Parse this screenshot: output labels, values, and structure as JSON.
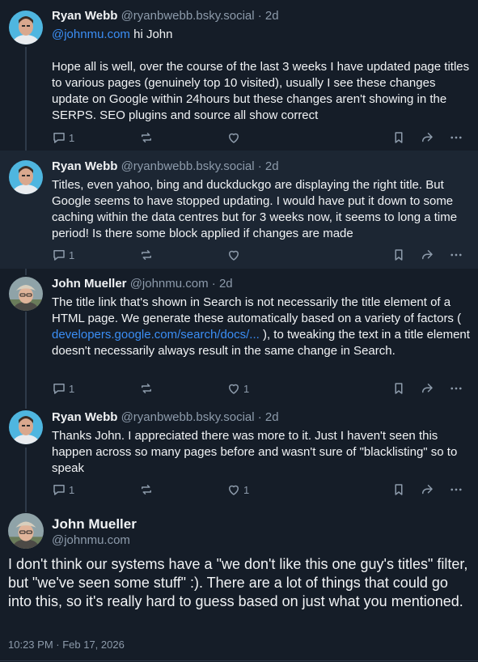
{
  "posts": [
    {
      "name": "Ryan Webb",
      "handle": "@ryanbwebb.bsky.social · 2d",
      "mention": "@johnmu.com",
      "line1_rest": " hi John",
      "para2": "Hope all is well, over the course of the last 3 weeks I have updated page titles to various pages (genuinely top 10 visited), usually I see these changes update on Google within 24hours but these changes aren't showing in the SERPS. SEO plugins and source all show correct",
      "reply_count": "1",
      "like_count": ""
    },
    {
      "name": "Ryan Webb",
      "handle": "@ryanbwebb.bsky.social · 2d",
      "text": "Titles, even yahoo, bing and duckduckgo are displaying the right title. But Google seems to have stopped updating. I would have put it down to some caching within the data centres but for 3 weeks now, it seems to long a time period! Is there some block applied if changes are made",
      "reply_count": "1",
      "like_count": ""
    },
    {
      "name": "John Mueller",
      "handle": "@johnmu.com · 2d",
      "text_before": "The title link that's shown in Search is not necessarily the title element of a HTML page. We generate these automatically based on a variety of factors ( ",
      "link": "developers.google.com/search/docs/...",
      "text_after": " ), to tweaking the text in a title element doesn't necessarily always result in the same change in Search.",
      "reply_count": "1",
      "like_count": "1"
    },
    {
      "name": "Ryan Webb",
      "handle": "@ryanbwebb.bsky.social · 2d",
      "text": "Thanks John. I appreciated there was more to it. Just I haven't seen this happen across so many pages before and wasn't sure of \"blacklisting\" so to speak",
      "reply_count": "1",
      "like_count": "1"
    }
  ],
  "main_post": {
    "name": "John Mueller",
    "handle": "@johnmu.com",
    "text": "I don't think our systems have a \"we don't like this one guy's titles\" filter, but \"we've seen some stuff\" :). There are a lot of things that could go into this, so it's really hard to guess based on just what you mentioned.",
    "timestamp": "10:23 PM · Feb 17, 2026"
  },
  "icons": {
    "reply": "reply-bubble-icon",
    "repost": "repost-icon",
    "like": "heart-icon",
    "bookmark": "bookmark-icon",
    "share": "share-icon",
    "more": "more-dots-icon"
  },
  "colors": {
    "background": "#151d28",
    "highlight": "#1c2633",
    "link": "#3b8ef5",
    "muted": "#8d9bab"
  }
}
